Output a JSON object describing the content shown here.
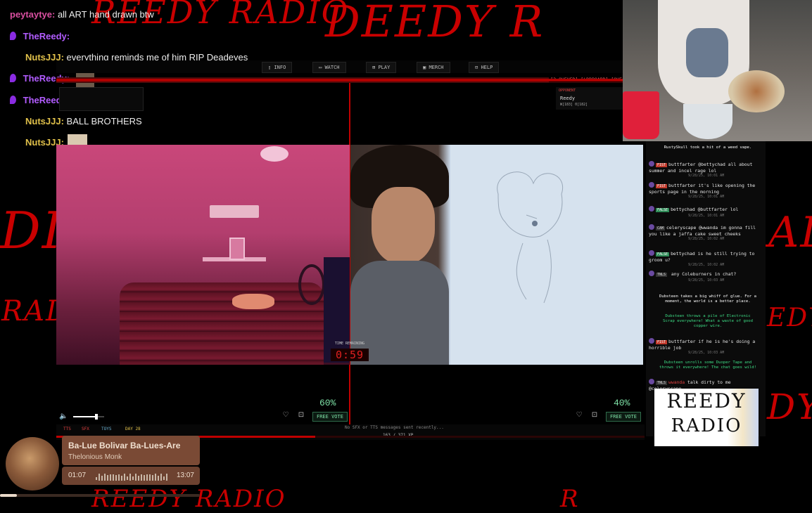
{
  "background": {
    "scribbles": [
      "REEDY RADIO",
      "DEEDY R",
      "DI",
      "AD",
      "RADI",
      "EDY",
      "DY",
      "REEDY RADIO",
      "R"
    ]
  },
  "overlay_chat": [
    {
      "user": "peytaytye:",
      "text": "all ART hand drawn btw",
      "color": "#d94fa0",
      "has_dot": false
    },
    {
      "user": "TheReedy:",
      "text": "",
      "color": "#b25cff",
      "has_dot": true
    },
    {
      "user": "NutsJJJ:",
      "text": "everything reminds me of him RIP Deadeyes",
      "color": "#e0c04a",
      "has_dot": false
    },
    {
      "user": "TheReedy:",
      "text": "",
      "color": "#b25cff",
      "has_dot": true
    },
    {
      "user": "TheReedy:",
      "text": "",
      "color": "#b25cff",
      "has_dot": true
    },
    {
      "user": "NutsJJJ:",
      "text": "BALL BROTHERS",
      "color": "#e0c04a",
      "has_dot": false
    },
    {
      "user": "NutsJJJ:",
      "text": "",
      "color": "#e0c04a",
      "has_dot": false
    }
  ],
  "nav": {
    "items": [
      "INFO",
      "WATCH",
      "PLAY",
      "MERCH",
      "HELP"
    ],
    "right_text": "[3 QUEUED] [LDRBOARD] [QUE"
  },
  "opponent_card": {
    "label": "OPPONENT",
    "name": "Reedy",
    "stats": "W[183] 0[182]"
  },
  "timer": {
    "label": "TIME REMAINING",
    "value": "0:59"
  },
  "votes": {
    "left": {
      "percent": "60%",
      "button": "FREE VOTE"
    },
    "right": {
      "percent": "40%",
      "button": "FREE VOTE"
    }
  },
  "volume": {
    "level": 0.75
  },
  "status_bar": {
    "tags": [
      "TTS",
      "SFX",
      "TOYS",
      "DAY 28"
    ],
    "message": "No SFX or TTS messages sent recently...",
    "xp": "163 / 371 XP",
    "xp_fraction": 0.44
  },
  "side_chat": {
    "messages": [
      {
        "type": "system",
        "text": "RustySkull took a hit of a weed vape.",
        "color": "#ffffff"
      },
      {
        "type": "chat",
        "badge": "FIST",
        "badge_color": "#c0392b",
        "name": "buttfarter",
        "text": "@bettychad all about summer and incel rage lol",
        "ts": "9/28/25, 10:01 AM"
      },
      {
        "type": "chat",
        "badge": "FIST",
        "badge_color": "#c0392b",
        "name": "buttfarter",
        "text": "it's like opening the sports page in the morning",
        "ts": "9/28/25, 10:01 AM"
      },
      {
        "type": "chat",
        "badge": "FALSE",
        "badge_color": "#2e8b57",
        "name": "bettychad",
        "text": "@buttfarter lol",
        "ts": "9/28/25, 10:01 AM"
      },
      {
        "type": "chat",
        "badge": "CAM",
        "badge_color": "#333333",
        "name": "celeryscape",
        "text": "@wwanda im gonna fill you like a jaffa cake sweet cheeks",
        "ts": "9/28/25, 10:02 AM"
      },
      {
        "type": "chat",
        "badge": "FALSE",
        "badge_color": "#2e8b57",
        "name": "bettychad",
        "text": "is he still trying to groom u?",
        "ts": "9/28/25, 10:02 AM"
      },
      {
        "type": "chat",
        "badge": "TNLS",
        "badge_color": "#333333",
        "name": "",
        "text": "any Coleburners in chat?",
        "ts": "9/28/25, 10:03 AM"
      },
      {
        "type": "system",
        "text": "Dubsteen takes a big whiff of glue. For a moment, the world is a better place.",
        "color": "#ffffff"
      },
      {
        "type": "system",
        "text": "Dubsteen throws a pile of Electronic Scrap everywhere! What a waste of good copper wire.",
        "color": "#3ddc84"
      },
      {
        "type": "chat",
        "badge": "FIST",
        "badge_color": "#c0392b",
        "name": "buttfarter",
        "text": "if he is he's doing a horrible job",
        "ts": "9/28/25, 10:03 AM"
      },
      {
        "type": "system",
        "text": "Dubsteen unrolls some Duoper Tape and throws it everywhere! The chat goes wild!",
        "color": "#3ddc84"
      },
      {
        "type": "chat",
        "badge": "TNLS",
        "badge_color": "#333333",
        "name": "wwanda",
        "text": "talk dirty to me @celeryscape",
        "ts": ""
      }
    ]
  },
  "logo": {
    "line1": "REEDY",
    "line2": "RADIO"
  },
  "now_playing": {
    "title": "Ba-Lue Bolivar Ba-Lues-Are",
    "artist": "Thelonious Monk",
    "elapsed": "01:07",
    "duration": "13:07",
    "progress": 0.085
  },
  "colors": {
    "accent_red": "#c00000",
    "vote_green": "#7fe3a8"
  }
}
